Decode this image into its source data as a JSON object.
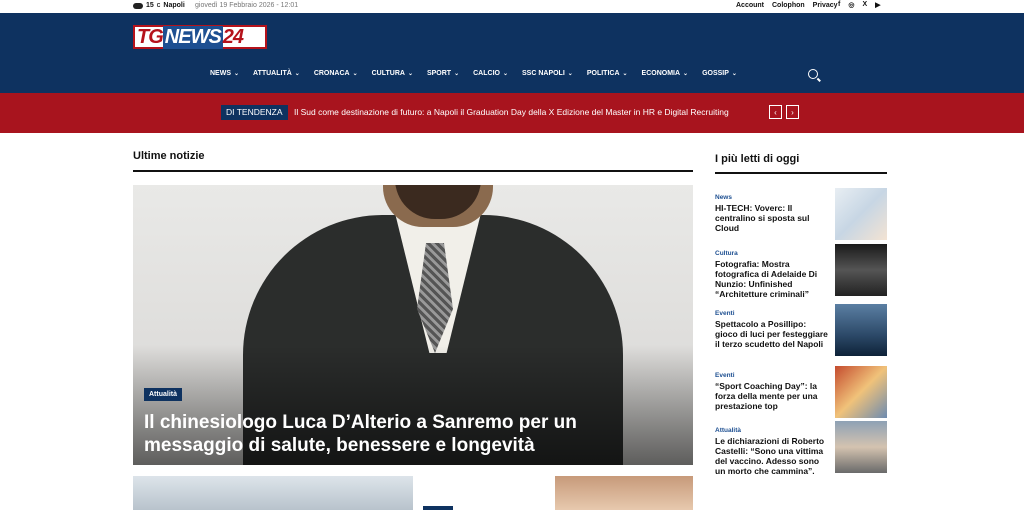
{
  "topbar": {
    "temp": "15",
    "unit": "C",
    "city": "Napoli",
    "date": "giovedì 19 Febbraio 2026 - 12:01",
    "links": [
      "Account",
      "Colophon",
      "Privacy"
    ],
    "social": [
      "f",
      "◎",
      "X",
      "▶"
    ]
  },
  "logo": {
    "tg": "TG",
    "news": "NEWS",
    "n24": "24"
  },
  "nav": [
    "NEWS",
    "ATTUALITÀ",
    "CRONACA",
    "CULTURA",
    "SPORT",
    "CALCIO",
    "SSC NAPOLI",
    "POLITICA",
    "ECONOMIA",
    "GOSSIP"
  ],
  "trending": {
    "tag": "DI TENDENZA",
    "text": "Il Sud come destinazione di futuro: a Napoli il Graduation Day della X Edizione del Master in HR e Digital Recruiting",
    "prev": "‹",
    "next": "›"
  },
  "main": {
    "section_title": "Ultime notizie",
    "hero": {
      "category": "Attualità",
      "title": "Il chinesiologo Luca D’Alterio a Sanremo per un messaggio di salute, benessere e longevità"
    }
  },
  "sidebar": {
    "title": "I più letti di oggi",
    "items": [
      {
        "category": "News",
        "title": "HI-TECH: Voverc: Il centralino si sposta sul Cloud"
      },
      {
        "category": "Cultura",
        "title": "Fotografia: Mostra fotografica di Adelaide Di Nunzio: Unfinished “Architetture criminali”"
      },
      {
        "category": "Eventi",
        "title": "Spettacolo a Posillipo: gioco di luci per festeggiare il terzo scudetto del Napoli"
      },
      {
        "category": "Eventi",
        "title": "“Sport Coaching Day”: la forza della mente per una prestazione top"
      },
      {
        "category": "Attualità",
        "title": "Le dichiarazioni di Roberto Castelli: “Sono una vittima del vaccino. Adesso sono un morto che cammina”."
      }
    ]
  }
}
